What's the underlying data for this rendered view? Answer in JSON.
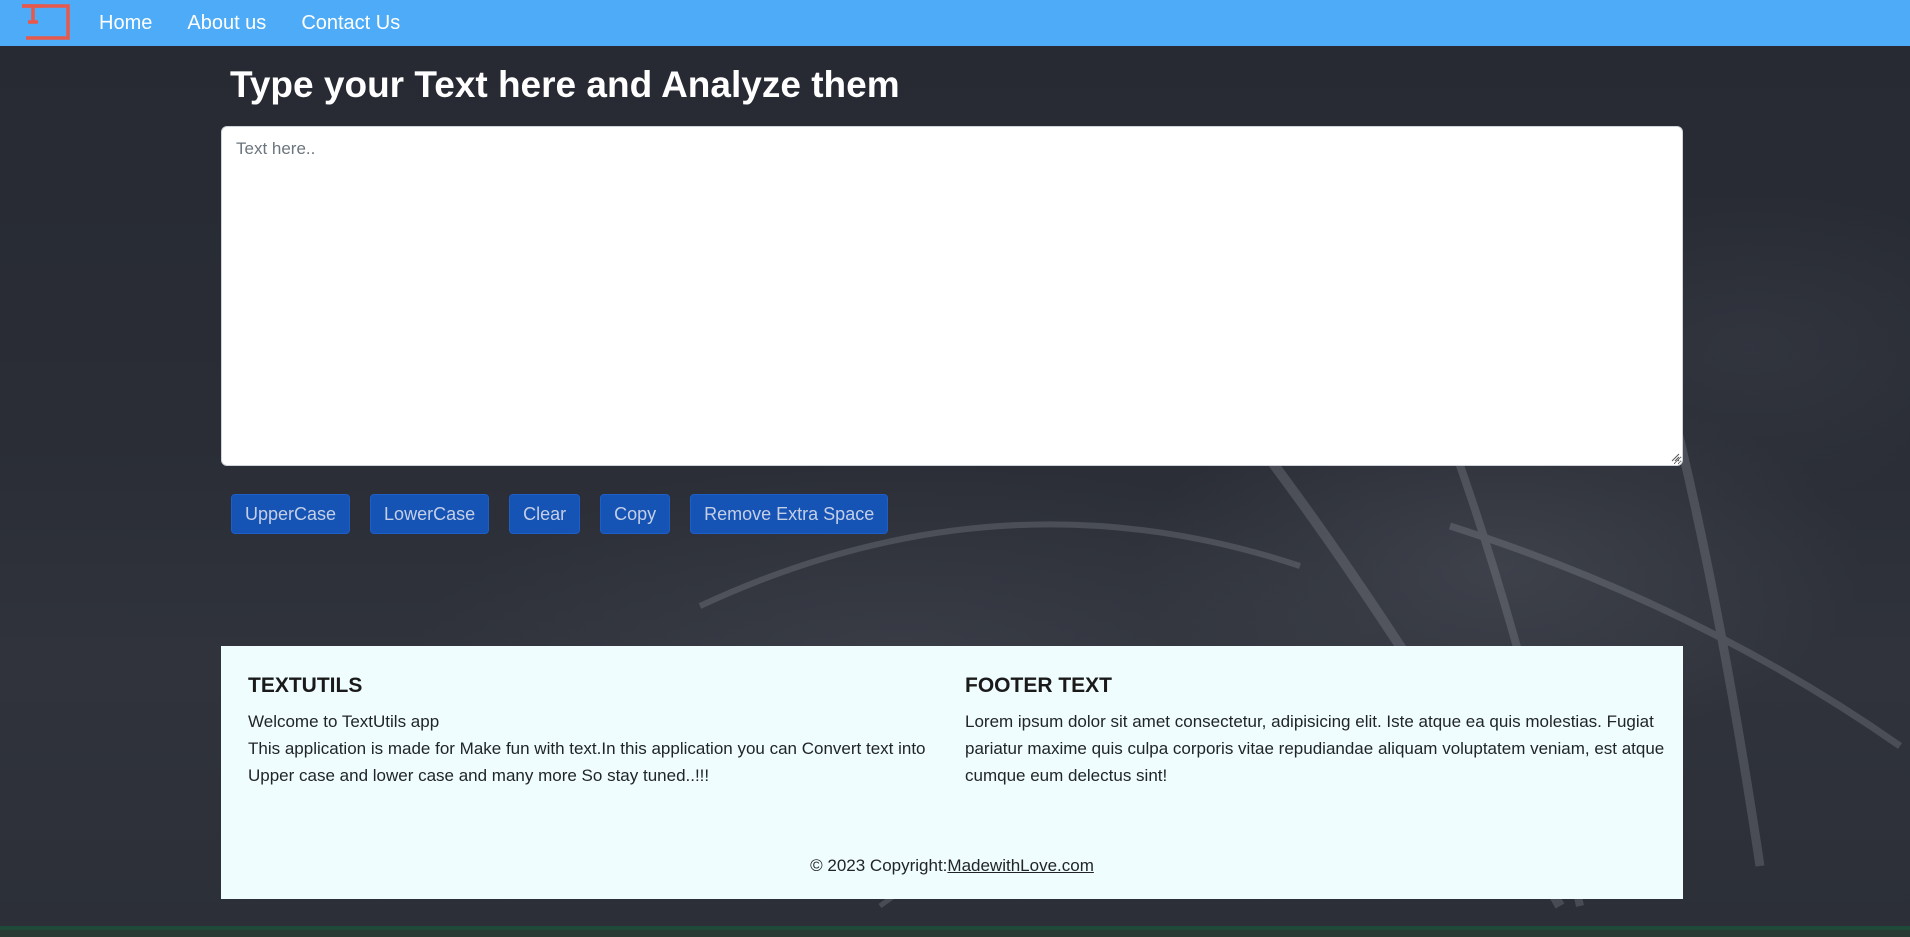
{
  "navbar": {
    "logo_icon": "textutils-logo-icon",
    "links": [
      {
        "label": "Home"
      },
      {
        "label": "About us"
      },
      {
        "label": "Contact Us"
      }
    ],
    "background": "#4dabf7"
  },
  "main": {
    "title": "Type your Text here and Analyze them",
    "textarea": {
      "placeholder": "Text here..",
      "value": ""
    },
    "buttons": [
      {
        "label": "UpperCase"
      },
      {
        "label": "LowerCase"
      },
      {
        "label": "Clear"
      },
      {
        "label": "Copy"
      },
      {
        "label": "Remove Extra Space"
      }
    ],
    "button_color": "#1553b5"
  },
  "footer": {
    "left": {
      "heading": "TEXTUTILS",
      "line1": "Welcome to TextUtils app",
      "line2": "This application is made for Make fun with text.In this application you can Convert text into Upper case and lower case and many more So stay tuned..!!!"
    },
    "right": {
      "heading": "FOOTER TEXT",
      "text": "Lorem ipsum dolor sit amet consectetur, adipisicing elit. Iste atque ea quis molestias. Fugiat pariatur maxime quis culpa corporis vitae repudiandae aliquam voluptatem veniam, est atque cumque eum delectus sint!"
    },
    "copyright_prefix": "© 2023 Copyright:",
    "copyright_link": "MadewithLove.com",
    "background": "#effdfe"
  }
}
